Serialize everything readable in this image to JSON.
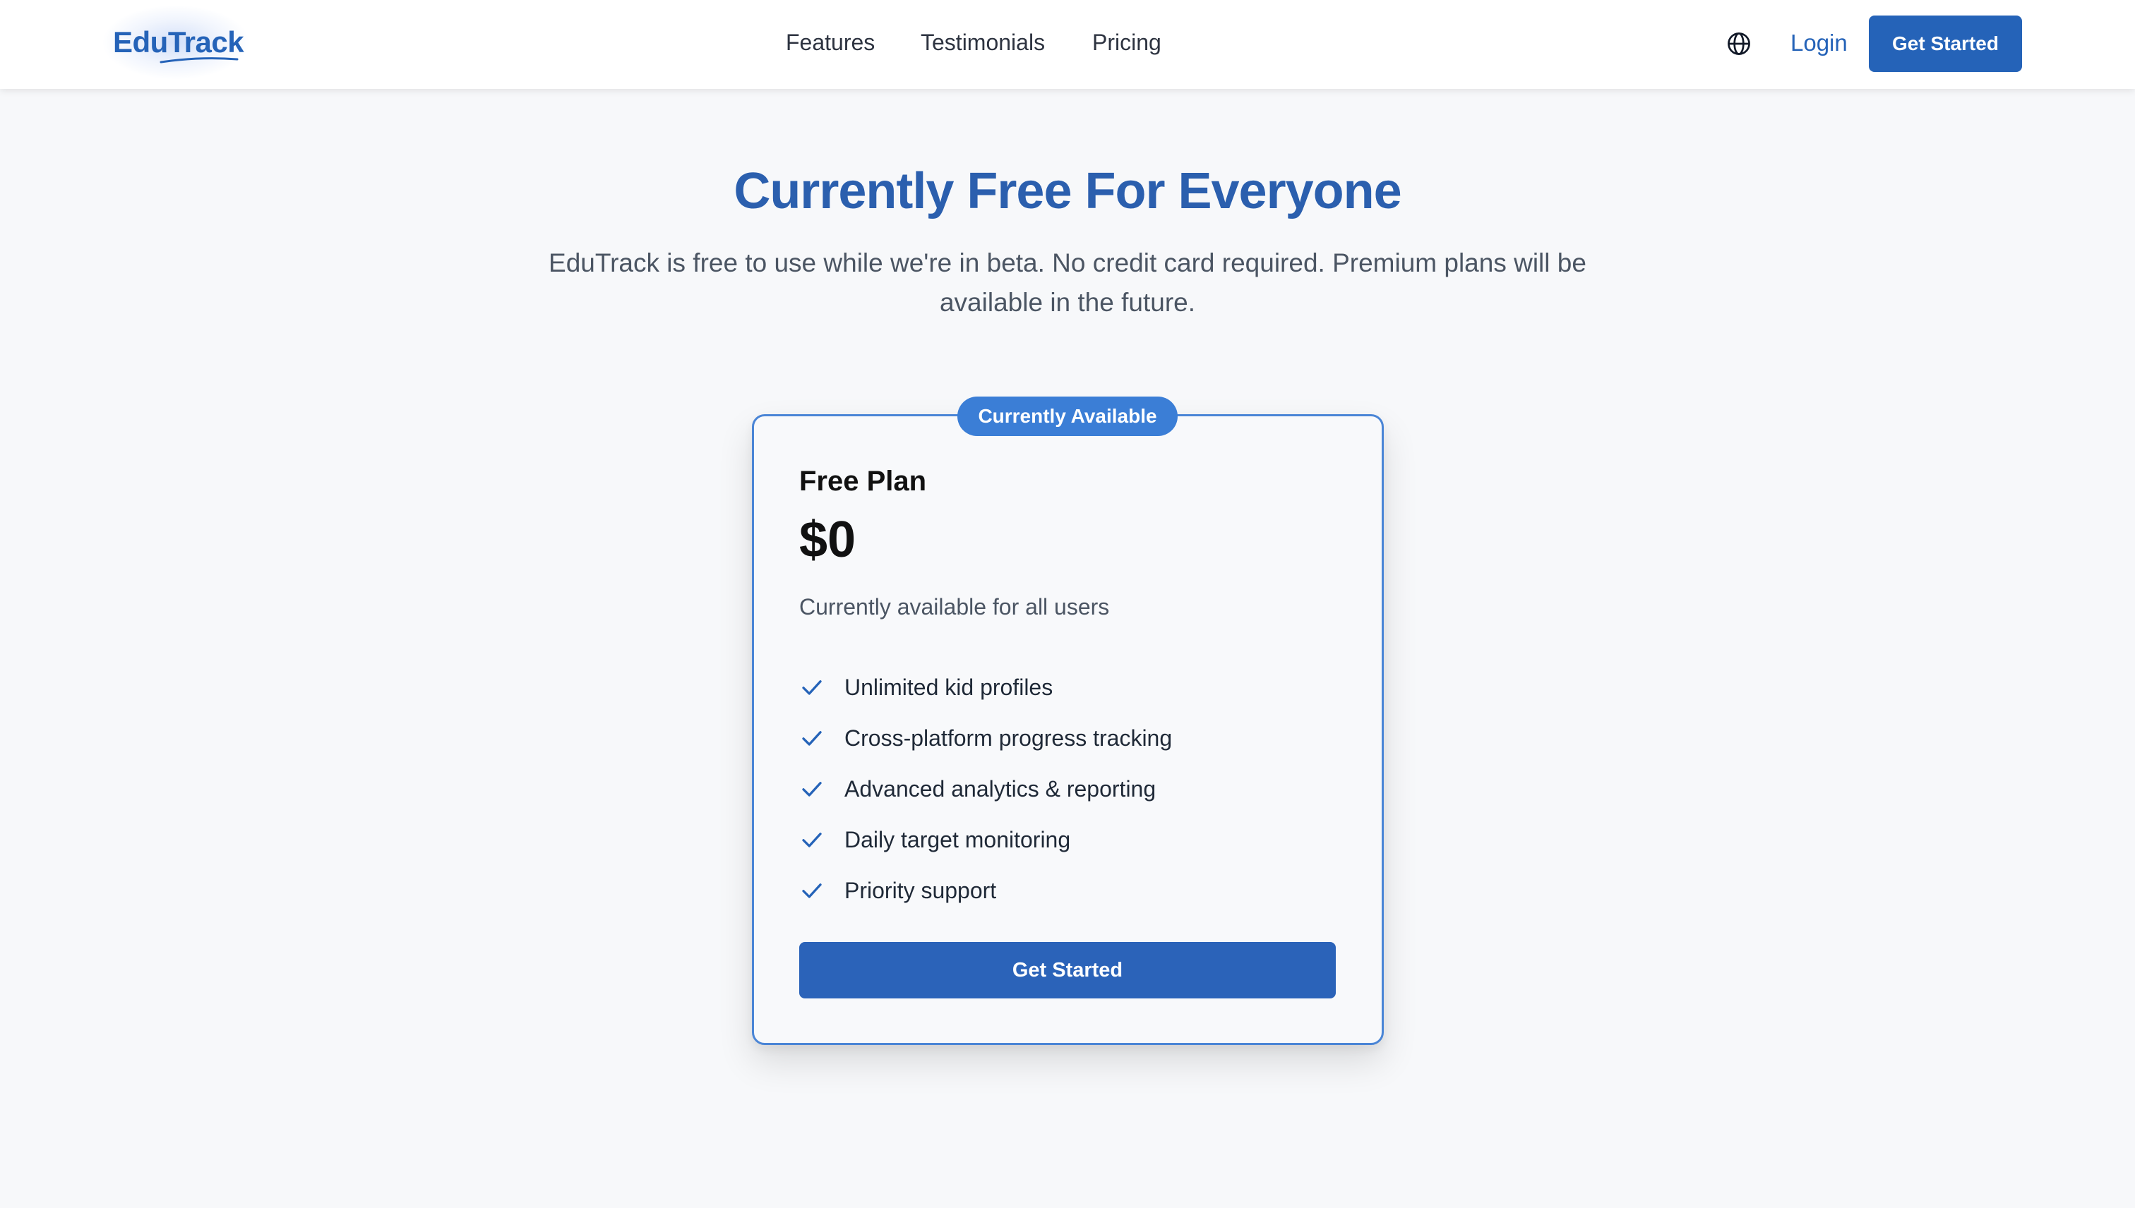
{
  "brand": {
    "name": "EduTrack",
    "accent": "#2563b8",
    "badge_color": "#3b7ed6",
    "bg": "#f7f8fa"
  },
  "nav": {
    "links": [
      "Features",
      "Testimonials",
      "Pricing"
    ],
    "globe_icon": "globe-icon",
    "login_label": "Login",
    "cta_label": "Get Started"
  },
  "hero": {
    "title": "Currently Free For Everyone",
    "subtitle": "EduTrack is free to use while we're in beta. No credit card required. Premium plans will be available in the future."
  },
  "plan": {
    "badge": "Currently Available",
    "name": "Free Plan",
    "price": "$0",
    "description": "Currently available for all users",
    "features": [
      "Unlimited kid profiles",
      "Cross-platform progress tracking",
      "Advanced analytics & reporting",
      "Daily target monitoring",
      "Priority support"
    ],
    "feature_icon": "check-icon",
    "cta_label": "Get Started"
  }
}
